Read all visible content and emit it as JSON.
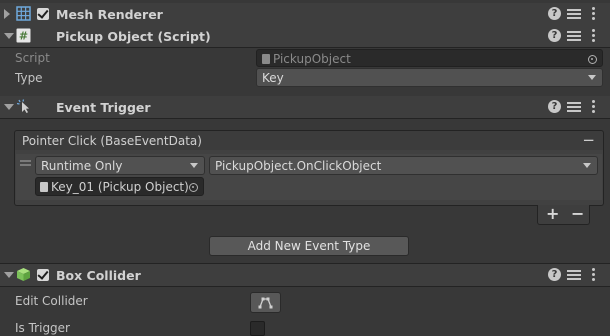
{
  "mesh_renderer": {
    "title": "Mesh Renderer",
    "enabled": true
  },
  "pickup_object": {
    "title": "Pickup Object (Script)",
    "script_label": "Script",
    "script_value": "PickupObject",
    "type_label": "Type",
    "type_value": "Key"
  },
  "event_trigger": {
    "title": "Event Trigger",
    "event_header": "Pointer Click (BaseEventData)",
    "remove_symbol": "−",
    "runtime_value": "Runtime Only",
    "function_value": "PickupObject.OnClickObject",
    "object_value": "Key_01 (Pickup Object)",
    "add_symbol": "+",
    "minus_symbol": "−",
    "add_event_button": "Add New Event Type"
  },
  "box_collider": {
    "title": "Box Collider",
    "enabled": true,
    "edit_collider_label": "Edit Collider",
    "is_trigger_label": "Is Trigger"
  },
  "header_icons": {
    "help": "?",
    "presets": "sliders-icon",
    "menu": "kebab-icon"
  },
  "colors": {
    "background": "#383838",
    "header": "#3e3e3e",
    "field": "#2a2a2a",
    "button": "#585858",
    "collider_green": "#8bd06a"
  }
}
